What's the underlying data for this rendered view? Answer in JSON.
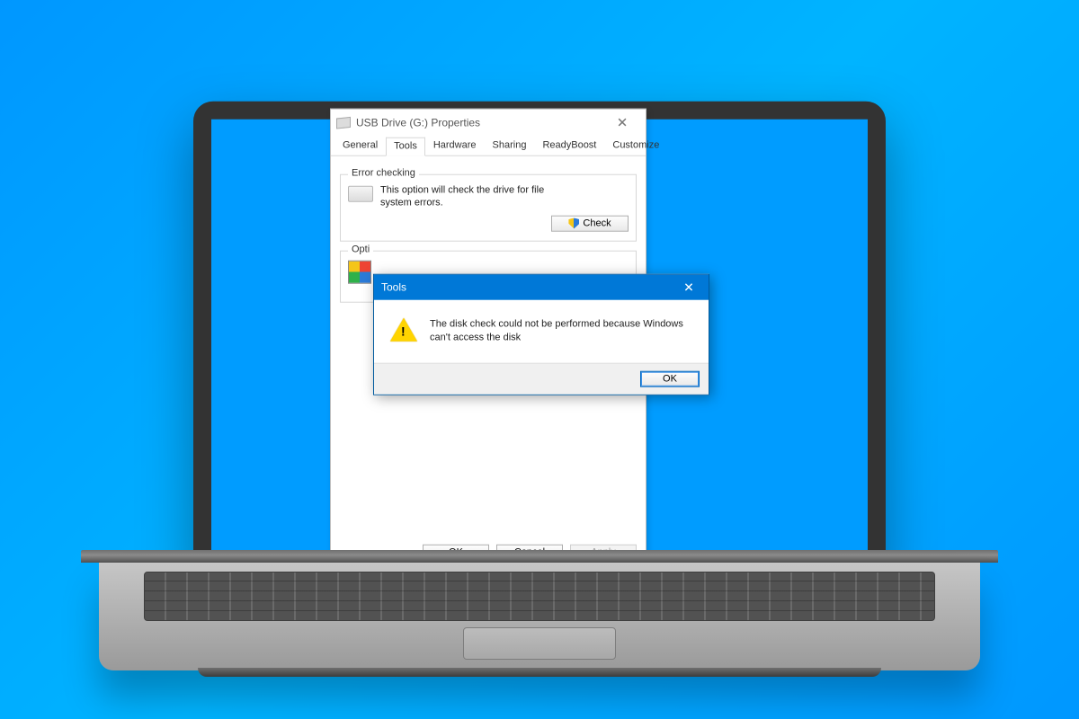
{
  "properties": {
    "title": "USB Drive (G:) Properties",
    "tabs": [
      "General",
      "Tools",
      "Hardware",
      "Sharing",
      "ReadyBoost",
      "Customize"
    ],
    "active_tab": "Tools",
    "group_error_checking": {
      "legend": "Error checking",
      "text": "This option will check the drive for file system errors.",
      "button": "Check"
    },
    "group_optimize": {
      "legend_visible_prefix": "Opti"
    },
    "footer": {
      "ok": "OK",
      "cancel": "Cancel",
      "apply": "Apply"
    }
  },
  "error_dialog": {
    "title": "Tools",
    "message": "The disk check could not be performed because Windows can't access the disk",
    "ok": "OK"
  }
}
